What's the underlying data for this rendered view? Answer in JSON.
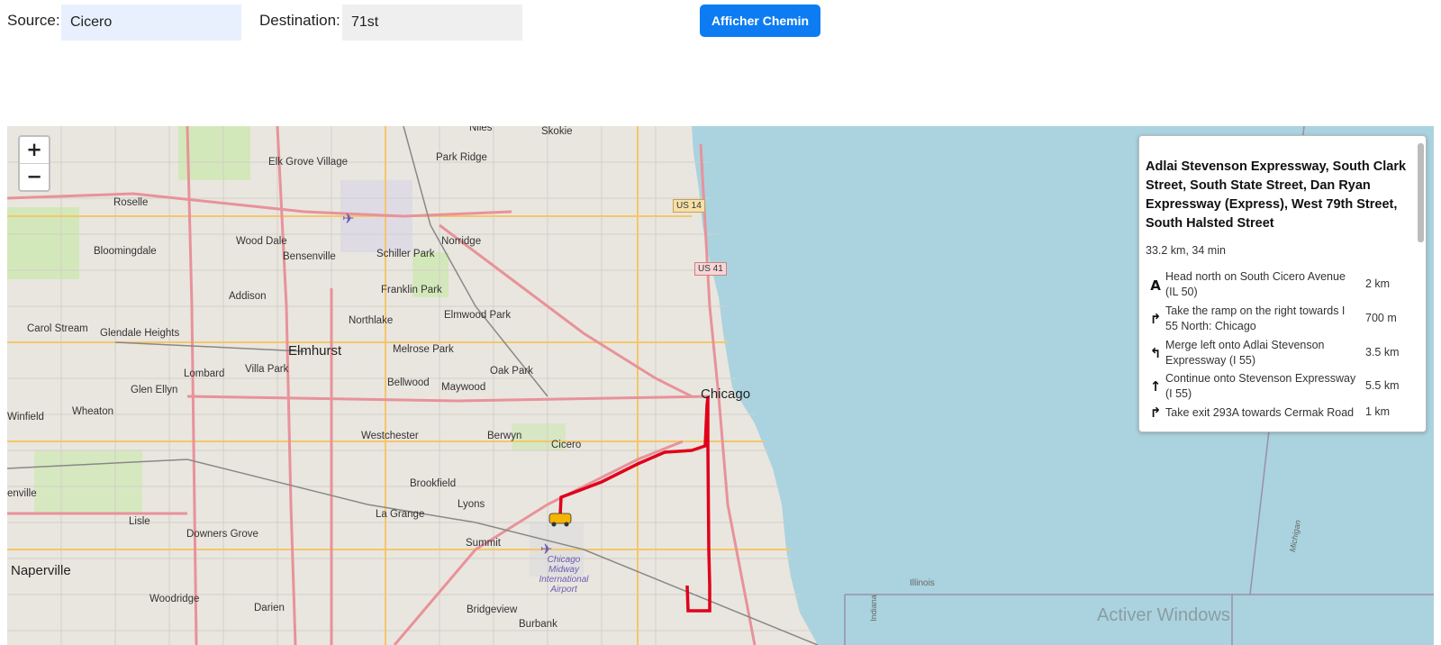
{
  "form": {
    "source_label": "Source:",
    "source_value": "Cicero",
    "destination_label": "Destination:",
    "destination_value": "71st",
    "submit_label": "Afficher Chemin"
  },
  "map": {
    "zoom_in": "+",
    "zoom_out": "−",
    "places": {
      "niles": "Niles",
      "skokie": "Skokie",
      "elk_grove": "Elk Grove Village",
      "park_ridge": "Park Ridge",
      "roselle": "Roselle",
      "wood_dale": "Wood Dale",
      "norridge": "Norridge",
      "bensenville": "Bensenville",
      "schiller_park": "Schiller Park",
      "bloomingdale": "Bloomingdale",
      "franklin_park": "Franklin Park",
      "addison": "Addison",
      "northlake": "Northlake",
      "elmwood_park": "Elmwood Park",
      "carol_stream": "Carol Stream",
      "glendale_heights": "Glendale Heights",
      "elmhurst": "Elmhurst",
      "melrose_park": "Melrose Park",
      "oak_park": "Oak Park",
      "lombard": "Lombard",
      "villa_park": "Villa Park",
      "bellwood": "Bellwood",
      "maywood": "Maywood",
      "chicago": "Chicago",
      "glen_ellyn": "Glen Ellyn",
      "winfield": "Winfield",
      "wheaton": "Wheaton",
      "westchester": "Westchester",
      "berwyn": "Berwyn",
      "cicero": "Cicero",
      "brookfield": "Brookfield",
      "lyons": "Lyons",
      "la_grange": "La Grange",
      "lisle": "Lisle",
      "downers_grove": "Downers Grove",
      "summit": "Summit",
      "naperville": "Naperville",
      "woodridge": "Woodridge",
      "darien": "Darien",
      "bridgeview": "Bridgeview",
      "burbank": "Burbank",
      "illinois": "Illinois",
      "michigan": "Michigan",
      "indiana": "Indiana",
      "enville": "enville",
      "midway": "Chicago Midway International Airport"
    },
    "shields": {
      "us14": "US 14",
      "us41": "US 41"
    },
    "watermark": "Activer Windows"
  },
  "route": {
    "title": "Adlai Stevenson Expressway, South Clark Street, South State Street, Dan Ryan Expressway (Express), West 79th Street, South Halsted Street",
    "summary": "33.2 km, 34 min",
    "instructions": [
      {
        "icon": "depart-icon",
        "glyph": "A",
        "text": "Head north on South Cicero Avenue (IL 50)",
        "distance": "2 km"
      },
      {
        "icon": "turn-right-icon",
        "glyph": "↱",
        "text": "Take the ramp on the right towards I 55 North: Chicago",
        "distance": "700 m"
      },
      {
        "icon": "turn-left-icon",
        "glyph": "↰",
        "text": "Merge left onto Adlai Stevenson Expressway (I 55)",
        "distance": "3.5 km"
      },
      {
        "icon": "straight-icon",
        "glyph": "↑",
        "text": "Continue onto Stevenson Expressway (I 55)",
        "distance": "5.5 km"
      },
      {
        "icon": "turn-right-icon",
        "glyph": "↱",
        "text": "Take exit 293A towards Cermak Road",
        "distance": "1 km"
      }
    ]
  },
  "colors": {
    "accent": "#0d7cf2",
    "route": "#e0001b",
    "water": "#aad3df"
  }
}
